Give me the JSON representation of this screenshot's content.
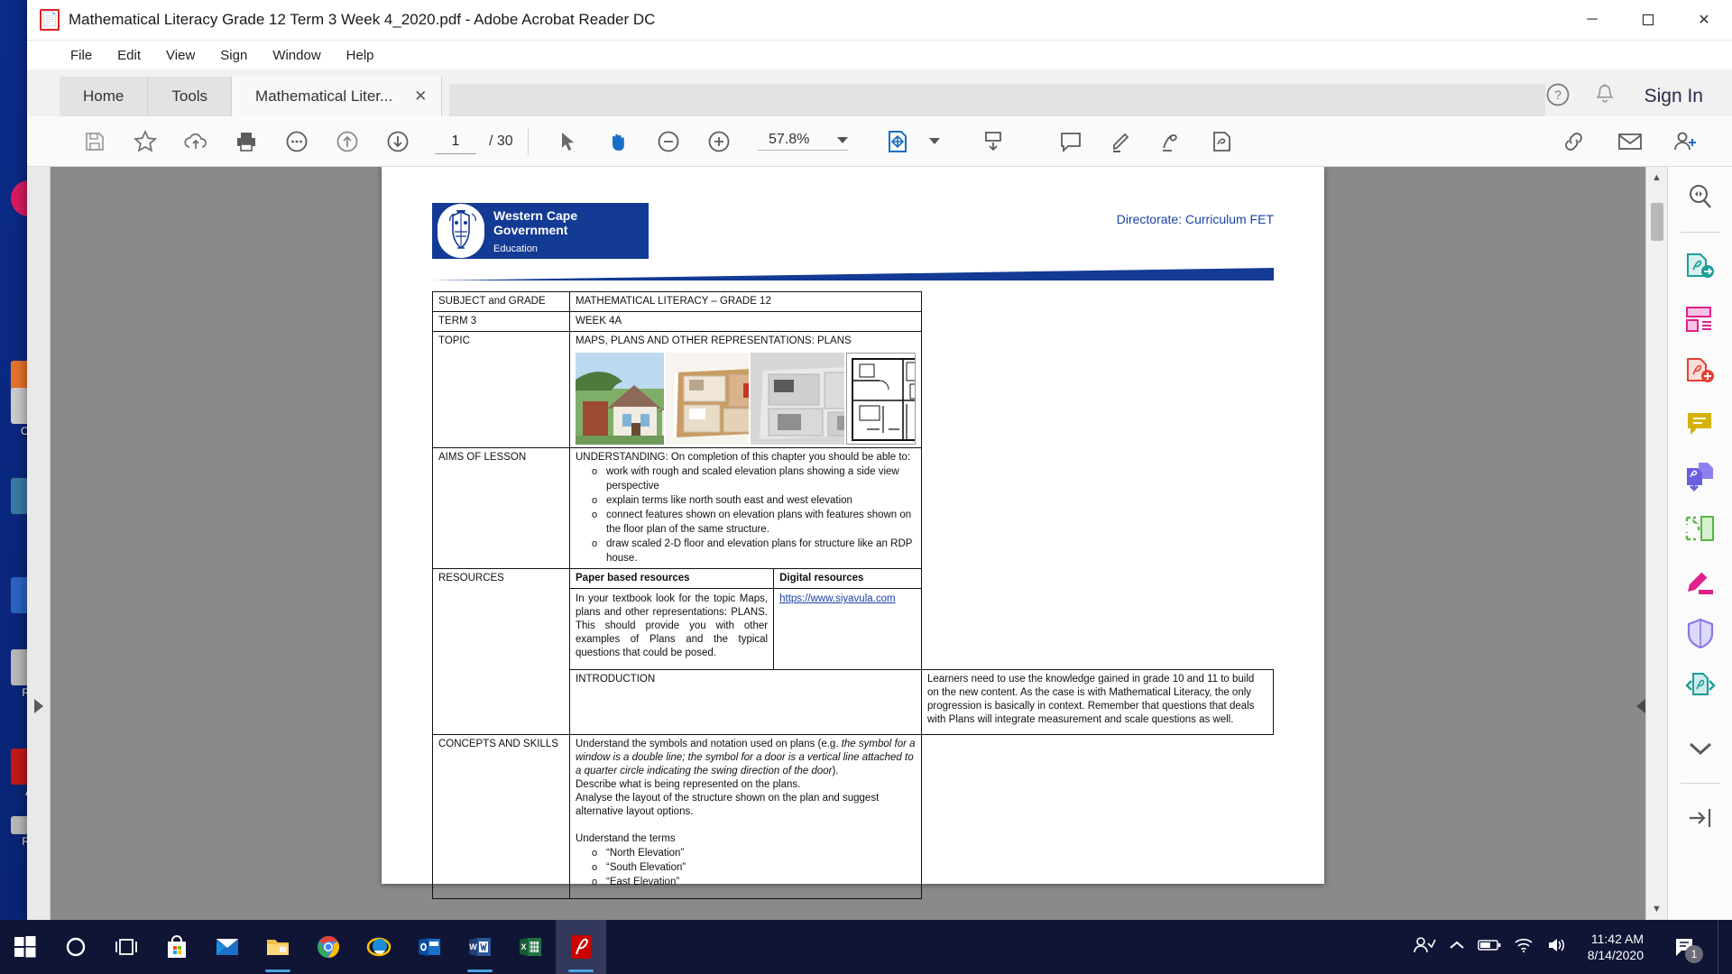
{
  "window": {
    "title": "Mathematical Literacy Grade 12 Term 3 Week 4_2020.pdf - Adobe Acrobat Reader DC",
    "app_icon": "pdf-icon",
    "minimize": "─",
    "maximize": "☐",
    "close": "✕"
  },
  "menu": {
    "items": [
      "File",
      "Edit",
      "View",
      "Sign",
      "Window",
      "Help"
    ]
  },
  "tabs": {
    "home": "Home",
    "tools": "Tools",
    "document": "Mathematical Liter...",
    "close_glyph": "✕",
    "help_icon": "help-circle-icon",
    "bell_icon": "bell-icon",
    "signin": "Sign In"
  },
  "toolbar": {
    "left_icons": [
      "save-icon",
      "star-icon",
      "cloud-upload-icon",
      "print-icon",
      "comment-icon",
      "page-up-icon",
      "page-down-icon"
    ],
    "page_number": "1",
    "page_total": "/ 30",
    "select_icon": "cursor-select-icon",
    "hand_icon": "hand-tool-icon",
    "zoom_out_icon": "zoom-out-icon",
    "zoom_in_icon": "zoom-in-icon",
    "zoom_value": "57.8%",
    "fit_icon": "fit-page-icon",
    "scroll_mode_icon": "scroll-mode-icon",
    "comment_tool_icon": "add-comment-icon",
    "highlight_icon": "highlight-icon",
    "draw_icon": "draw-icon",
    "fill_sign_icon": "fill-and-sign-icon",
    "share_link_icon": "share-link-icon",
    "email_icon": "email-icon",
    "add_person_icon": "add-person-icon"
  },
  "right_tools": [
    {
      "name": "search-tool-icon",
      "color": "#5a5a5a",
      "label": "Search"
    },
    {
      "name": "export-pdf-icon",
      "color": "#1a9e96",
      "label": "Export PDF"
    },
    {
      "name": "organise-pages-icon",
      "color": "#e0218a",
      "label": "Organise Pages"
    },
    {
      "name": "create-pdf-icon",
      "color": "#e34234",
      "label": "Create PDF"
    },
    {
      "name": "comment-tool-icon",
      "color": "#d4b20a",
      "label": "Comment"
    },
    {
      "name": "combine-files-icon",
      "color": "#6a5de0",
      "label": "Combine Files"
    },
    {
      "name": "edit-pdf-icon",
      "color": "#57b847",
      "label": "Edit PDF"
    },
    {
      "name": "highlight-tool-icon",
      "color": "#e0218a",
      "label": "Highlight"
    },
    {
      "name": "protect-icon",
      "color": "#8878e8",
      "label": "Protect"
    },
    {
      "name": "compress-pdf-icon",
      "color": "#1a9e96",
      "label": "Compress PDF"
    },
    {
      "name": "chevron-down-icon",
      "color": "#5a5a5a",
      "label": "More Tools"
    },
    {
      "name": "expand-panel-icon",
      "color": "#5a5a5a",
      "label": "Expand"
    }
  ],
  "document": {
    "logo": {
      "line1": "Western Cape",
      "line2": "Government",
      "line3": "Education"
    },
    "directorate": "Directorate: Curriculum FET",
    "rows": {
      "subject_label": "SUBJECT and GRADE",
      "subject_value": "MATHEMATICAL LITERACY – GRADE 12",
      "term_label": "TERM 3",
      "term_value": "WEEK 4A",
      "topic_label": "TOPIC",
      "topic_value": "MAPS, PLANS AND OTHER REPRESENTATIONS: PLANS",
      "aims_label": "AIMS OF LESSON",
      "aims_intro": "UNDERSTANDING: On completion of this chapter you should be able to:",
      "aims_items": [
        "work with rough and scaled elevation plans showing a side view perspective",
        "explain terms like north south east and west elevation",
        "connect features shown on elevation plans with features shown on the floor plan of the same structure.",
        "draw scaled 2-D floor and elevation plans for structure like an RDP house."
      ],
      "resources_label": "RESOURCES",
      "resources_paper_header": "Paper based resources",
      "resources_digital_header": "Digital resources",
      "resources_paper_text": "In your textbook look for the topic Maps, plans and other representations: PLANS. This should provide you with other examples of Plans and the typical questions that could be posed.",
      "resources_digital_link": "https://www.siyavula.com",
      "introduction_label": "INTRODUCTION",
      "introduction_text": "Learners need to use the knowledge gained in grade 10 and 11 to build on the new content. As the case is with Mathematical Literacy, the only progression is basically in context. Remember that questions that deals with Plans will integrate measurement and scale questions as well.",
      "concepts_label": "CONCEPTS AND SKILLS",
      "concepts_p1_a": "Understand the symbols and notation used on plans (e.g. ",
      "concepts_p1_italic": "the symbol for a window is a double line; the symbol for a door is a vertical line attached to a quarter circle indicating the swing direction of the door",
      "concepts_p1_b": ").",
      "concepts_p2": "Describe what is being represented on the plans.",
      "concepts_p3": "Analyse the layout of the structure shown on the plan and suggest alternative layout options.",
      "concepts_terms_intro": "Understand the terms",
      "concepts_terms": [
        "“North Elevation”",
        "“South Elevation”",
        "“East Elevation”"
      ]
    },
    "topic_images": [
      {
        "name": "house-photo",
        "alt": "Photograph of a suburban house exterior"
      },
      {
        "name": "3d-floor-plan-colour",
        "alt": "3D colour floor plan of a home"
      },
      {
        "name": "3d-floor-plan-grey",
        "alt": "3D grey floor plan of an apartment"
      },
      {
        "name": "architectural-floor-plan",
        "alt": "Black and white architectural floor plan"
      }
    ]
  },
  "taskbar": {
    "apps": [
      "start-icon",
      "cortana-icon",
      "task-view-icon",
      "microsoft-store-icon",
      "mail-icon",
      "file-explorer-icon",
      "chrome-icon",
      "internet-explorer-icon",
      "outlook-icon",
      "word-icon",
      "excel-icon",
      "acrobat-icon"
    ],
    "tray": [
      "people-icon",
      "show-hidden-icons-icon",
      "battery-icon",
      "wifi-icon",
      "volume-icon"
    ],
    "time": "11:42 AM",
    "date": "8/14/2020",
    "notification_count": "1"
  },
  "desktop_icons": [
    {
      "label": "",
      "color": "#d81b60"
    },
    {
      "label": "",
      "color": "#e8722a"
    },
    {
      "label": "Oly",
      "color": "#dddddd"
    },
    {
      "label": "",
      "color": "#3a7ca5"
    },
    {
      "label": "",
      "color": "#2b62c4"
    },
    {
      "label": "Re",
      "color": "#c9c9c9"
    },
    {
      "label": "A",
      "color": "#c41818"
    },
    {
      "label": "Re",
      "color": "#c9c9c9"
    }
  ],
  "colors": {
    "wcg_blue": "#133a94",
    "accent_link": "#1a43a8",
    "taskbar": "#101536"
  }
}
